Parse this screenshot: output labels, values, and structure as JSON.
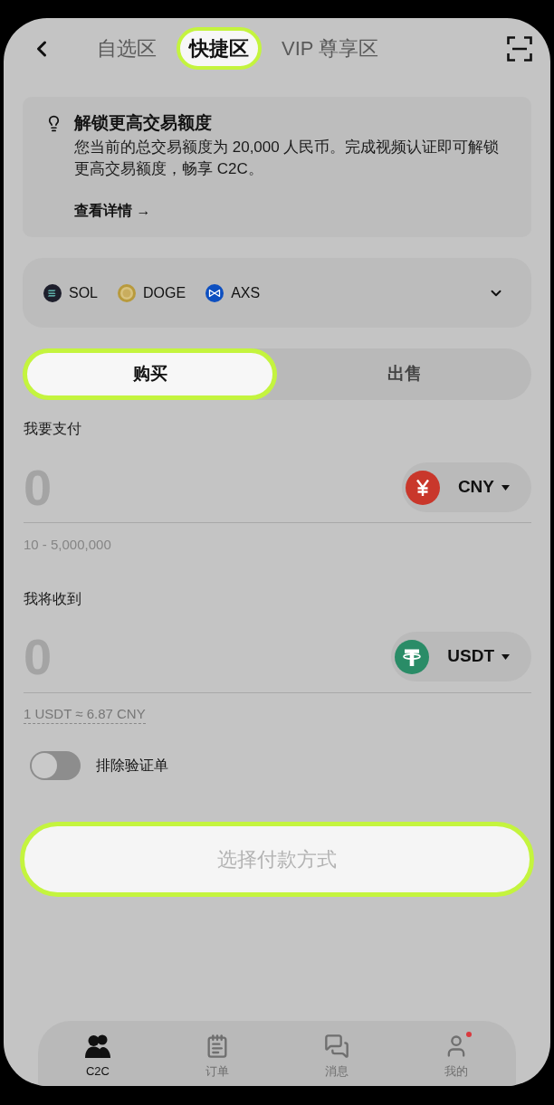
{
  "header": {
    "tabs": [
      {
        "label": "自选区",
        "selected": false
      },
      {
        "label": "快捷区",
        "selected": true
      },
      {
        "label": "VIP 尊享区",
        "selected": false
      }
    ]
  },
  "notice": {
    "title": "解锁更高交易额度",
    "body": "您当前的总交易额度为 20,000 人民币。完成视频认证即可解锁更高交易额度，畅享 C2C。",
    "link": "查看详情 →"
  },
  "coins": [
    {
      "symbol": "SOL"
    },
    {
      "symbol": "DOGE"
    },
    {
      "symbol": "AXS"
    }
  ],
  "trade_side": [
    {
      "label": "购买",
      "selected": true
    },
    {
      "label": "出售",
      "selected": false
    }
  ],
  "pay": {
    "label": "我要支付",
    "placeholder": "0",
    "currency": "CNY",
    "range": "10 - 5,000,000"
  },
  "receive": {
    "label": "我将收到",
    "placeholder": "0",
    "currency": "USDT",
    "rate": "1 USDT ≈ 6.87 CNY"
  },
  "exclude_verified": {
    "label": "排除验证单",
    "on": false
  },
  "submit": {
    "label": "选择付款方式",
    "highlighted": true,
    "disabled": true
  },
  "nav": [
    {
      "label": "C2C",
      "selected": true,
      "dot": false
    },
    {
      "label": "订单",
      "selected": false,
      "dot": false
    },
    {
      "label": "消息",
      "selected": false,
      "dot": false
    },
    {
      "label": "我的",
      "selected": false,
      "dot": true
    }
  ]
}
